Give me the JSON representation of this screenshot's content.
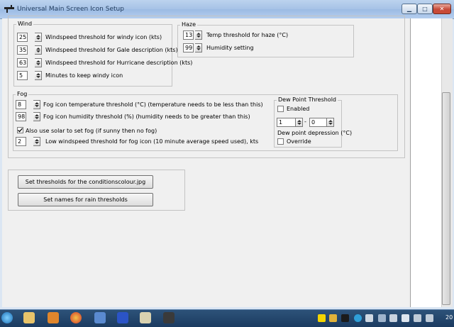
{
  "window": {
    "title": "Universal Main Screen Icon Setup"
  },
  "wind": {
    "title": "Wind",
    "rows": [
      {
        "value": "25",
        "label": "Windspeed threshold for windy icon (kts)"
      },
      {
        "value": "35",
        "label": "Windspeed threshold for Gale description (kts)"
      },
      {
        "value": "63",
        "label": "Windspeed threshold for Hurricane description (kts)"
      },
      {
        "value": "5",
        "label": "Minutes to keep windy icon"
      }
    ]
  },
  "haze": {
    "title": "Haze",
    "rows": [
      {
        "value": "13",
        "label": "Temp threshold for haze (°C)"
      },
      {
        "value": "99",
        "label": "Humidity setting"
      }
    ]
  },
  "fog": {
    "title": "Fog",
    "temp": {
      "value": "8",
      "label": "Fog icon temperature threshold (°C) (temperature needs to be less than this)"
    },
    "humidity": {
      "value": "98",
      "label": "Fog icon humidity threshold (%) (humidity needs to be greater than this)"
    },
    "solar": {
      "checked": true,
      "label": "Also use solar to set fog (if sunny then no fog)"
    },
    "wind": {
      "value": "2",
      "label": "Low windspeed threshold for fog icon (10 minute average speed used), kts"
    }
  },
  "dewpoint": {
    "title": "Dew Point Threshold",
    "enabled_label": "Enabled",
    "low": "1",
    "separator": "-",
    "high": "0",
    "depression_label": "Dew point depression (°C)",
    "override_label": "Override"
  },
  "buttons": {
    "thresholds": "Set thresholds for the conditionscolour.jpg",
    "rain_names": "Set names for rain thresholds"
  },
  "taskbar": {
    "clock": "20"
  },
  "colors": {
    "accent": "#1e395b",
    "taskbar": "#1b3b61",
    "close": "#c74b3a"
  }
}
